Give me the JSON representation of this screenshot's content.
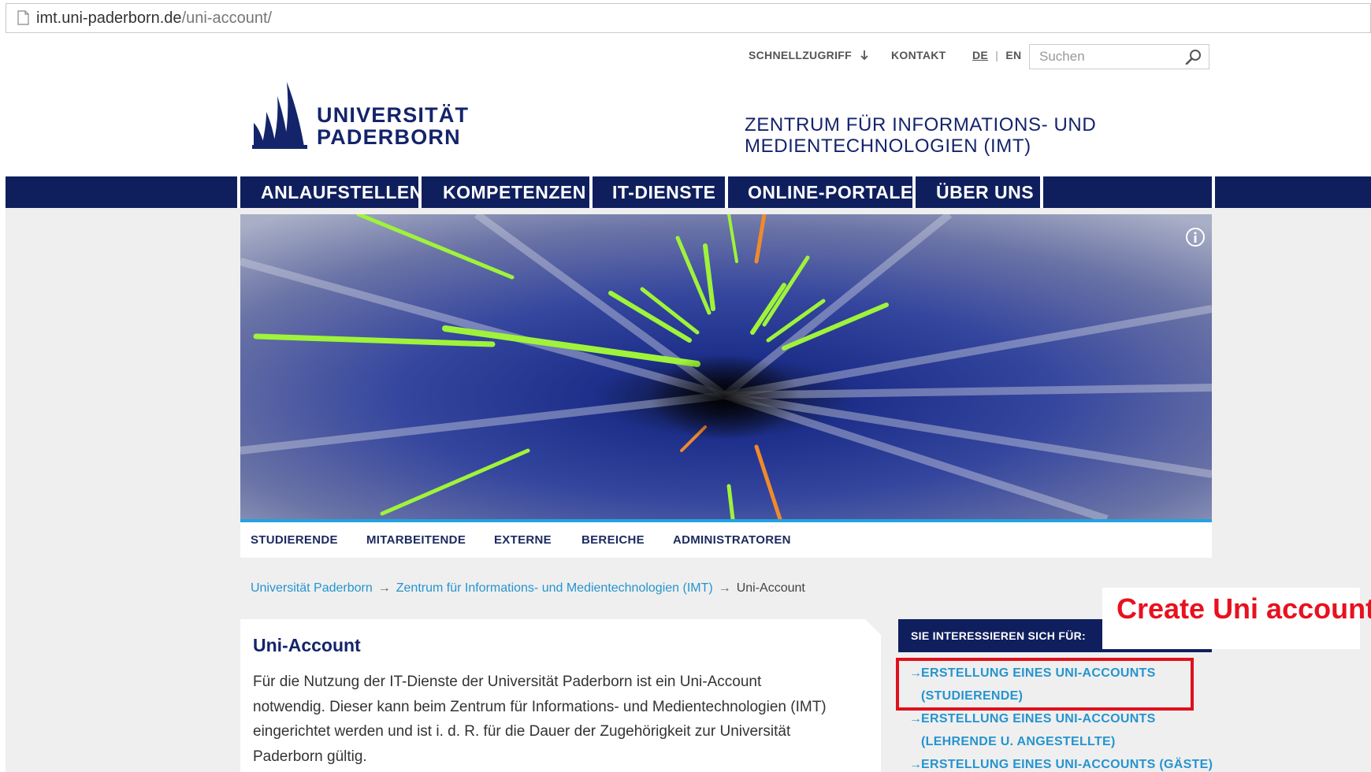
{
  "browser": {
    "url_host": "imt.uni-paderborn.de",
    "url_path": "/uni-account/"
  },
  "meta_nav": {
    "quick_access": "SCHNELLZUGRIFF",
    "contact": "KONTAKT",
    "lang_de": "DE",
    "lang_sep": "|",
    "lang_en": "EN",
    "search_placeholder": "Suchen"
  },
  "logo": {
    "line1": "UNIVERSITÄT",
    "line2": "PADERBORN"
  },
  "site_title": {
    "line1": "ZENTRUM FÜR INFORMATIONS- UND",
    "line2": "MEDIENTECHNOLOGIEN (IMT)"
  },
  "main_nav": [
    "ANLAUFSTELLEN",
    "KOMPETENZEN",
    "IT-DIENSTE",
    "ONLINE-PORTALE",
    "ÜBER UNS"
  ],
  "sub_nav": [
    "STUDIERENDE",
    "MITARBEITENDE",
    "EXTERNE",
    "BEREICHE",
    "ADMINISTRATOREN"
  ],
  "breadcrumb": {
    "items": [
      "Universität Paderborn",
      "Zentrum für Informations- und Medientechnologien (IMT)"
    ],
    "arrow": "→",
    "current": "Uni-Account"
  },
  "content": {
    "title": "Uni-Account",
    "lines": [
      "Für die Nutzung der IT-Dienste der Universität Paderborn ist ein Uni-Account",
      "notwendig. Dieser kann beim Zentrum für Informations- und Medientechnologien (IMT)",
      "eingerichtet werden und ist i. d. R. für die Dauer der Zugehörigkeit zur Universität",
      "Paderborn gültig."
    ]
  },
  "sidebar": {
    "heading": "SIE INTERESSIEREN SICH FÜR:",
    "arrow": "→",
    "links": [
      {
        "line1": "ERSTELLUNG EINES UNI-ACCOUNTS",
        "line2": "(STUDIERENDE)"
      },
      {
        "line1": "ERSTELLUNG EINES UNI-ACCOUNTS",
        "line2": "(LEHRENDE U. ANGESTELLTE)"
      },
      {
        "line1": "ERSTELLUNG EINES UNI-ACCOUNTS (GÄSTE)",
        "line2": ""
      }
    ]
  },
  "annotation": {
    "text": "Create Uni account",
    "color": "#e8111e"
  },
  "colors": {
    "brand_navy": "#0f1f5e",
    "link_blue": "#2594cf",
    "accent_bar": "#21a3e0"
  },
  "icons": {
    "page": "page-icon",
    "search": "search-icon",
    "info": "info-icon",
    "quick_access_arrow": "arrow-down-icon"
  }
}
